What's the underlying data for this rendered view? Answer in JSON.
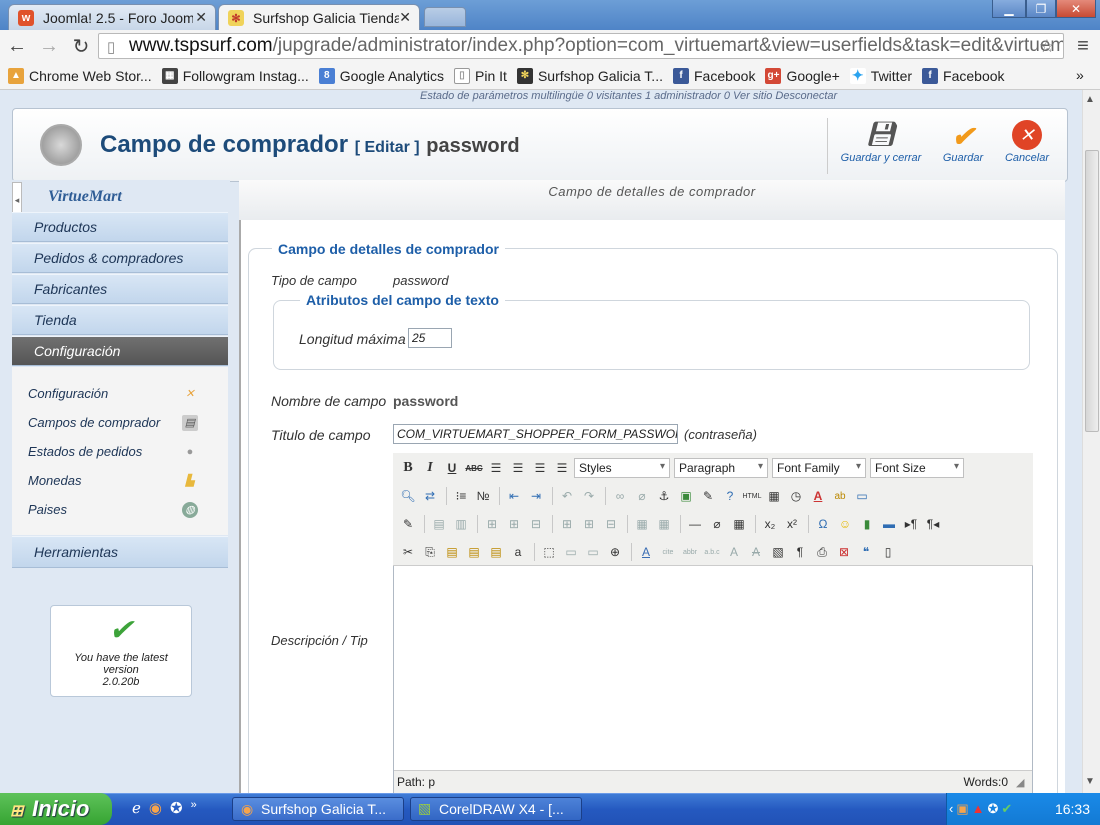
{
  "browser": {
    "tabs": [
      {
        "title": "Joomla! 2.5 - Foro Joom",
        "favicon": "w"
      },
      {
        "title": "Surfshop Galicia Tienda",
        "favicon": "surf-logo"
      }
    ],
    "url_host": "www.tspsurf.com",
    "url_path": "/jupgrade/administrator/index.php?option=com_virtuemart&view=userfields&task=edit&virtuemart_u",
    "bookmarks": [
      "Chrome Web Stor...",
      "Followgram Instag...",
      "Google Analytics",
      "Pin It",
      "Surfshop Galicia T...",
      "Facebook",
      "Google+",
      "Twitter",
      "Facebook"
    ],
    "more": "»"
  },
  "status_bar": "Estado de parámetros multilingüe   0 visitantes   1 administrador   0   Ver sitio   Desconectar",
  "header": {
    "title": "Campo de comprador",
    "edit_tag": "[ Editar ]",
    "record_name": "password",
    "buttons": {
      "save_close": "Guardar y cerrar",
      "save": "Guardar",
      "cancel": "Cancelar"
    }
  },
  "sidebar": {
    "logo": "VirtueMart",
    "items": [
      "Productos",
      "Pedidos & compradores",
      "Fabricantes",
      "Tienda",
      "Configuración"
    ],
    "subitems": [
      "Configuración",
      "Campos de comprador",
      "Estados de pedidos",
      "Monedas",
      "Paises"
    ],
    "tools": "Herramientas",
    "version_text": "You have the latest version",
    "version": "2.0.20b"
  },
  "form": {
    "tab_title": "Campo de detalles de comprador",
    "legend": "Campo de detalles de comprador",
    "tipo_label": "Tipo de campo",
    "tipo_value": "password",
    "attr_legend": "Atributos del campo de texto",
    "maxlen_label": "Longitud máxima",
    "maxlen_value": "25",
    "nombre_label": "Nombre de campo",
    "nombre_value": "password",
    "titulo_label": "Titulo de campo",
    "titulo_value": "COM_VIRTUEMART_SHOPPER_FORM_PASSWOR",
    "titulo_hint": "(contraseña)",
    "desc_label": "Descripción / Tip"
  },
  "editor": {
    "styles": "Styles",
    "format": "Paragraph",
    "font_family": "Font Family",
    "font_size": "Font Size",
    "path": "Path: p",
    "words": "Words:0"
  },
  "taskbar": {
    "start": "Inicio",
    "tasks": [
      "Surfshop Galicia T...",
      "CorelDRAW X4 - [..."
    ],
    "clock": "16:33"
  }
}
